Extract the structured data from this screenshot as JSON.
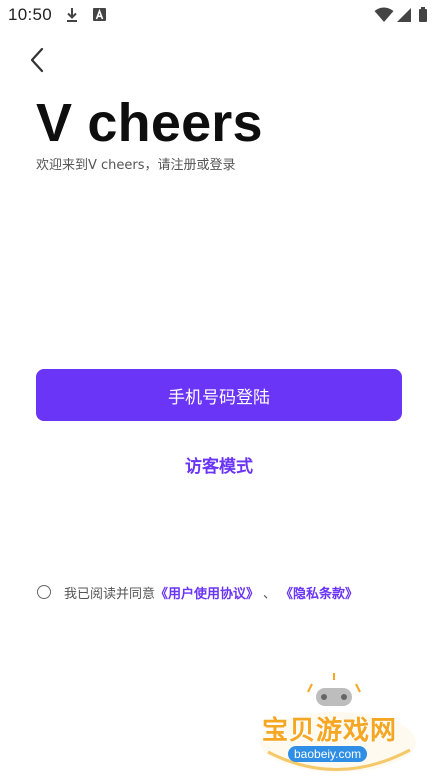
{
  "status_bar": {
    "time": "10:50",
    "icons": [
      "download-icon",
      "a-icon",
      "wifi-icon",
      "signal-icon",
      "battery-icon"
    ]
  },
  "header": {
    "back_icon": "chevron-left-icon"
  },
  "main": {
    "title": "V cheers",
    "subtitle": "欢迎来到V cheers，请注册或登录",
    "login_button": "手机号码登陆",
    "guest_link": "访客模式"
  },
  "agreement": {
    "prefix": "我已阅读并同意",
    "user_agreement": "《用户使用协议》",
    "separator": "、",
    "privacy_policy": "《隐私条款》"
  },
  "watermark": {
    "name": "宝贝游戏网",
    "domain": "baobeiy.com"
  },
  "colors": {
    "accent": "#6b35f8",
    "text_primary": "#0e0e0e",
    "text_secondary": "#555555"
  }
}
